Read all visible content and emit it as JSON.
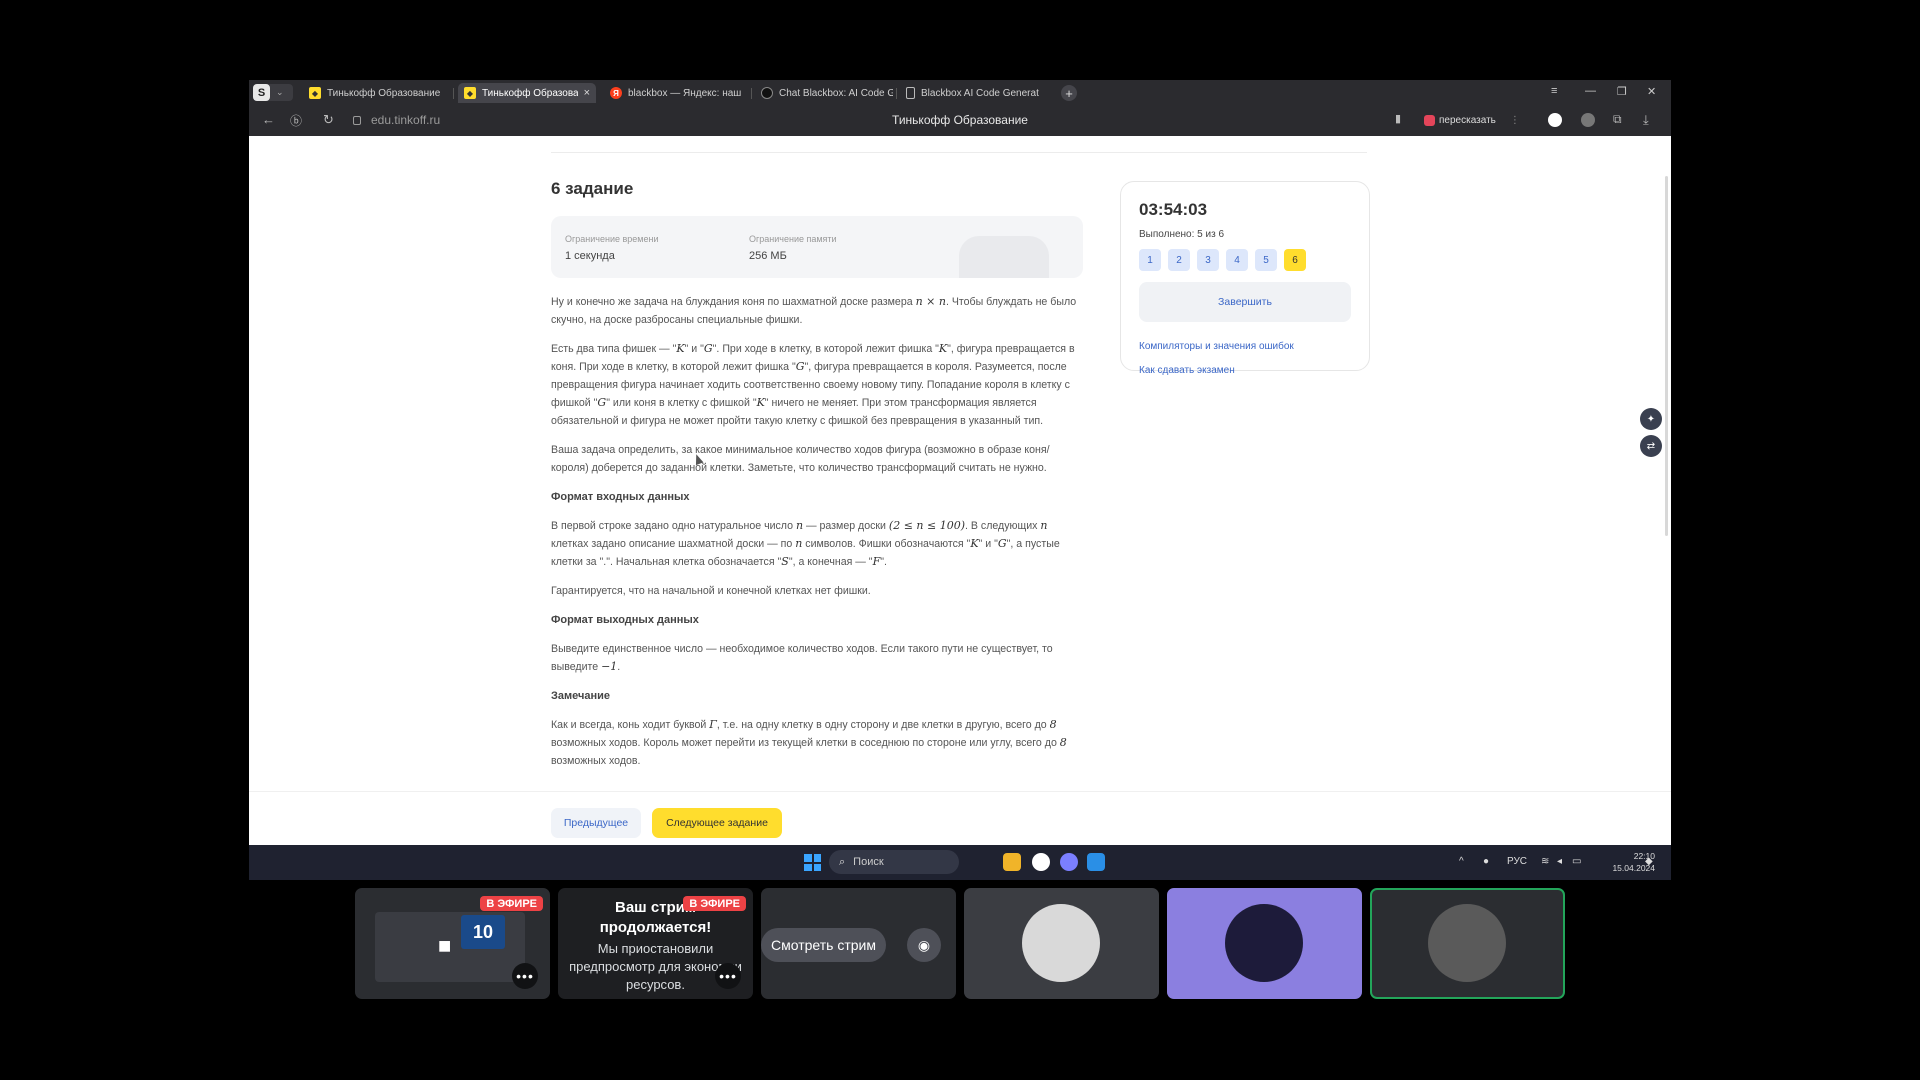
{
  "browser": {
    "profile_badge": "S",
    "tabs": [
      {
        "label": "Тинькофф Образование",
        "icon": "shield-icon",
        "active": false
      },
      {
        "label": "Тинькофф Образование",
        "icon": "shield-icon",
        "active": true,
        "close": "×"
      },
      {
        "label": "blackbox — Яндекс: наш",
        "icon": "yandex-icon",
        "active": false
      },
      {
        "label": "Chat Blackbox: AI Code Ge",
        "icon": "chat-icon",
        "active": false
      },
      {
        "label": "Blackbox AI Code Generat",
        "icon": "doc-icon",
        "active": false
      }
    ],
    "new_tab": "+",
    "url": "edu.tinkoff.ru",
    "page_title": "Тинькофф Образование",
    "retell_label": "пересказать",
    "accent": "#ffdd2d"
  },
  "task": {
    "title": "6 задание",
    "limits": {
      "time_label": "Ограничение времени",
      "time_value": "1 секунда",
      "memory_label": "Ограничение памяти",
      "memory_value": "256 МБ"
    },
    "p1": {
      "a": "Ну и конечно же задача на блуждания коня по шахматной доске размера ",
      "m1": "n × n",
      "b": ". Чтобы блуждать не было скучно, на доске разбросаны специальные фишки."
    },
    "p2": {
      "a": "Есть два типа фишек — \"",
      "m1": "K",
      "b": "\" и \"",
      "m2": "G",
      "c": "\". При ходе в клетку, в которой лежит фишка \"",
      "m3": "K",
      "d": "\", фигура превращается в коня. При ходе в клетку, в которой лежит фишка \"",
      "m4": "G",
      "e": "\", фигура превращается в короля. Разумеется, после превращения фигура начинает ходить соответственно своему новому типу. Попадание короля в клетку с фишкой \"",
      "m5": "G",
      "f": "\" или коня в клетку с фишкой \"",
      "m6": "K",
      "g": "\" ничего не меняет. При этом трансформация является обязательной и фигура не может пройти такую клетку с фишкой без превращения в указанный тип."
    },
    "p3": "Ваша задача определить, за какое минимальное количество ходов фигура (возможно в образе коня/короля) доберется до заданной клетки. Заметьте, что количество трансформаций считать не нужно.",
    "h_input": "Формат входных данных",
    "p4": {
      "a": "В первой строке задано одно натуральное число ",
      "m1": "n",
      "b": " — размер доски ",
      "m2": "(2 ≤ n ≤ 100)",
      "c": ". В следующих ",
      "m3": "n",
      "d": " клетках задано описание шахматной доски — по ",
      "m4": "n",
      "e": " символов. Фишки обозначаются \"",
      "m5": "K",
      "f": "\" и \"",
      "m6": "G",
      "g": "\", а пустые клетки за \".\". Начальная клетка обозначается \"",
      "m7": "S",
      "h": "\", а конечная — \"",
      "m8": "F",
      "i": "\"."
    },
    "p5": "Гарантируется, что на начальной и конечной клетках нет фишки.",
    "h_output": "Формат выходных данных",
    "p6": {
      "a": "Выведите единственное число — необходимое количество ходов. Если такого пути не существует, то выведите ",
      "m1": "−1",
      "b": "."
    },
    "h_note": "Замечание",
    "p7": {
      "a": "Как и всегда, конь ходит буквой ",
      "m1": "Γ",
      "b": ", т.е. на одну клетку в одну сторону и две клетки в другую, всего до ",
      "m2": "8",
      "c": " возможных ходов. Король может перейти из текущей клетки в соседнюю по стороне или углу, всего до ",
      "m3": "8",
      "d": " возможных ходов."
    }
  },
  "sidebar": {
    "timer": "03:54:03",
    "done": "Выполнено: 5 из 6",
    "tasks": [
      "1",
      "2",
      "3",
      "4",
      "5",
      "6"
    ],
    "current_task": "6",
    "finish": "Завершить",
    "link_compilers": "Компиляторы и значения ошибок",
    "link_exam": "Как сдавать экзамен"
  },
  "nav": {
    "prev": "Предыдущее",
    "next": "Следующее задание"
  },
  "taskbar": {
    "search_placeholder": "Поиск",
    "lang": "РУС",
    "time": "22:10",
    "date": "15.04.2024"
  },
  "streams": {
    "live_label": "В ЭФИРЕ",
    "menu": "•••",
    "tile1_text": "10",
    "paused_title": "Ваш стрим продолжается!",
    "paused_text": "Мы приостановили предпросмотр для экономии ресурсов.",
    "watch": "Смотреть стрим"
  }
}
